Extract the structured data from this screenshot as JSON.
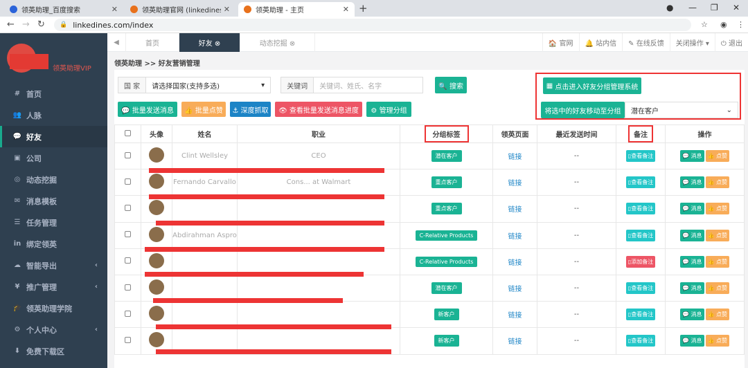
{
  "browser": {
    "tabs": [
      {
        "title": "领英助理_百度搜索",
        "color": "#2b63d9"
      },
      {
        "title": "领英助理官网 (linkedines.com)",
        "color": "#e8711c"
      },
      {
        "title": "领英助理 - 主页",
        "color": "#e8711c"
      }
    ],
    "url": "linkedines.com/index"
  },
  "sidebar": {
    "vip": "领英助理VIP",
    "items": [
      {
        "label": "首页",
        "icon": "#"
      },
      {
        "label": "人脉",
        "icon": "👥"
      },
      {
        "label": "好友",
        "icon": "💬"
      },
      {
        "label": "公司",
        "icon": "▣"
      },
      {
        "label": "动态挖掘",
        "icon": "◎"
      },
      {
        "label": "消息模板",
        "icon": "✉"
      },
      {
        "label": "任务管理",
        "icon": "☰"
      },
      {
        "label": "绑定领英",
        "icon": "in"
      },
      {
        "label": "智能导出",
        "icon": "☁"
      },
      {
        "label": "推广管理",
        "icon": "¥"
      },
      {
        "label": "领英助理学院",
        "icon": "🎓"
      },
      {
        "label": "个人中心",
        "icon": "⚙"
      },
      {
        "label": "免费下载区",
        "icon": "⬇"
      }
    ]
  },
  "topnav": {
    "tabs": [
      "首页",
      "好友 ⊗",
      "动态挖掘 ⊗"
    ],
    "right": [
      "🏠 官网",
      "🔔 站内信",
      "✎ 在线反馈",
      "关闭操作 ▾",
      "⏻ 退出"
    ]
  },
  "breadcrumb": "领英助理 >> 好友营销管理",
  "filters": {
    "country_label": "国 家",
    "country_value": "请选择国家(支持多选)",
    "keyword_label": "关键词",
    "keyword_placeholder": "关键词、姓氏、名字",
    "search": "🔍 搜索",
    "group_system": "点击进入好友分组管理系统",
    "move_label": "将选中的好友移动至分组",
    "move_value": "潜在客户"
  },
  "actions": [
    "💬 批量发送消息",
    "👍 批量点赞",
    "⚓ 深度抓取",
    "👁 查看批量发送消息进度",
    "⚙ 管理分组"
  ],
  "table": {
    "headers": [
      "头像",
      "姓名",
      "职业",
      "分组标签",
      "领英页面",
      "最近发送时间",
      "备注",
      "操作"
    ],
    "rows": [
      {
        "name": "Clint Wellsley",
        "job": "CEO",
        "tag": "潜在客户",
        "link": "链接",
        "time": "--",
        "note": "查看备注",
        "noteRed": false
      },
      {
        "name": "Fernando Carvallo",
        "job": "Cons... at Walmart",
        "tag": "重点客户",
        "link": "链接",
        "time": "--",
        "note": "查看备注",
        "noteRed": false
      },
      {
        "name": "",
        "job": "",
        "tag": "重点客户",
        "link": "链接",
        "time": "--",
        "note": "查看备注",
        "noteRed": false
      },
      {
        "name": "Abdirahman Aspro",
        "job": "",
        "tag": "C-Relative Products",
        "link": "链接",
        "time": "--",
        "note": "查看备注",
        "noteRed": false
      },
      {
        "name": "",
        "job": "",
        "tag": "C-Relative Products",
        "link": "链接",
        "time": "--",
        "note": "添加备注",
        "noteRed": true
      },
      {
        "name": "",
        "job": "",
        "tag": "潜在客户",
        "link": "链接",
        "time": "--",
        "note": "查看备注",
        "noteRed": false
      },
      {
        "name": "",
        "job": "",
        "tag": "新客户",
        "link": "链接",
        "time": "--",
        "note": "查看备注",
        "noteRed": false
      },
      {
        "name": "",
        "job": "",
        "tag": "新客户",
        "link": "链接",
        "time": "--",
        "note": "查看备注",
        "noteRed": false
      }
    ],
    "msg": "💬 消息",
    "like": "👍 点赞"
  }
}
